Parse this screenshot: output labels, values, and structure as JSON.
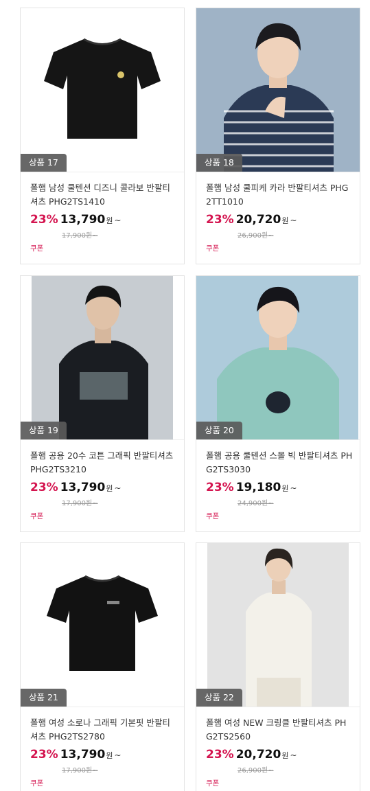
{
  "products": [
    {
      "rank": "상품 17",
      "name": "폴햄 남성 쿨텐션 디즈니 콜라보 반팔티셔츠 PHG2TS1410",
      "discount": "23%",
      "price": "13,790",
      "currency": "원",
      "tilde": "~",
      "original_price": "17,900원~",
      "coupon": "쿠폰"
    },
    {
      "rank": "상품 18",
      "name": "폴햄 남성 쿨피케 카라 반팔티셔츠 PHG2TT1010",
      "discount": "23%",
      "price": "20,720",
      "currency": "원",
      "tilde": "~",
      "original_price": "26,900원~",
      "coupon": "쿠폰"
    },
    {
      "rank": "상품 19",
      "name": "폴햄 공용 20수 코튼 그래픽 반팔티셔츠 PHG2TS3210",
      "discount": "23%",
      "price": "13,790",
      "currency": "원",
      "tilde": "~",
      "original_price": "17,900원~",
      "coupon": "쿠폰"
    },
    {
      "rank": "상품 20",
      "name": "폴햄 공용 쿨텐션 스몰 빅 반팔티셔츠 PHG2TS3030",
      "discount": "23%",
      "price": "19,180",
      "currency": "원",
      "tilde": "~",
      "original_price": "24,900원~",
      "coupon": "쿠폰"
    },
    {
      "rank": "상품 21",
      "name": "폴햄 여성 소로나 그래픽 기본핏 반팔티셔츠 PHG2TS2780",
      "discount": "23%",
      "price": "13,790",
      "currency": "원",
      "tilde": "~",
      "original_price": "17,900원~",
      "coupon": "쿠폰"
    },
    {
      "rank": "상품 22",
      "name": "폴햄 여성 NEW 크링클 반팔티셔츠 PHG2TS2560",
      "discount": "23%",
      "price": "20,720",
      "currency": "원",
      "tilde": "~",
      "original_price": "26,900원~",
      "coupon": "쿠폰"
    }
  ],
  "images": [
    {
      "icon": "black-tshirt-product-image",
      "bg": "#ffffff"
    },
    {
      "icon": "model-striped-polo-image",
      "bg": "#3a4a5e"
    },
    {
      "icon": "model-black-graphic-tee-image",
      "bg": "#c9ced4"
    },
    {
      "icon": "model-mint-graphic-tee-image",
      "bg": "#a8c8d8"
    },
    {
      "icon": "black-tshirt-product-image",
      "bg": "#ffffff"
    },
    {
      "icon": "model-white-tee-image",
      "bg": "#e6e6e6"
    }
  ]
}
